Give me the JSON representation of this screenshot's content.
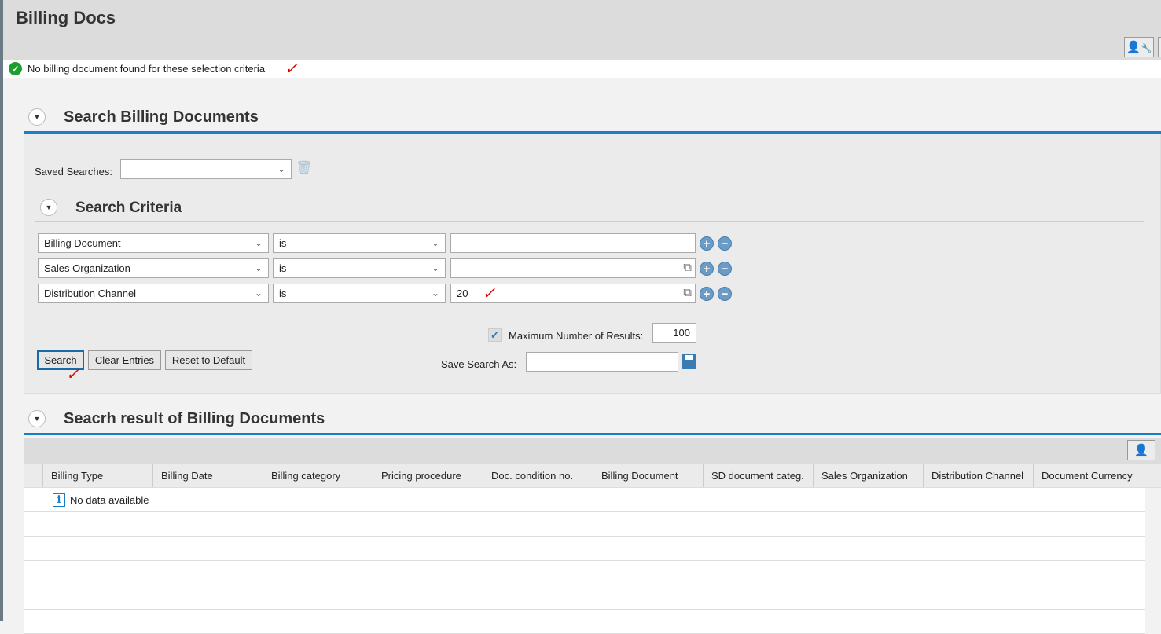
{
  "page": {
    "title": "Billing Docs"
  },
  "message": {
    "text": "No billing document found for these selection criteria",
    "annotation": "✓"
  },
  "search_section": {
    "title": "Search Billing Documents",
    "saved_searches_label": "Saved Searches:",
    "saved_searches_value": "",
    "criteria_title": "Search Criteria",
    "criteria": [
      {
        "field": "Billing Document",
        "operator": "is",
        "value": ""
      },
      {
        "field": "Sales Organization",
        "operator": "is",
        "value": ""
      },
      {
        "field": "Distribution Channel",
        "operator": "is",
        "value": "20"
      }
    ],
    "max_results_label": "Maximum Number of Results:",
    "max_results_checked": true,
    "max_results_value": "100",
    "save_as_label": "Save Search As:",
    "save_as_value": "",
    "buttons": {
      "search": "Search",
      "clear": "Clear Entries",
      "reset": "Reset to Default"
    }
  },
  "results_section": {
    "title": "Seacrh result of Billing Documents",
    "columns": [
      "Billing Type",
      "Billing Date",
      "Billing category",
      "Pricing procedure",
      "Doc. condition no.",
      "Billing Document",
      "SD document categ.",
      "Sales Organization",
      "Distribution Channel",
      "Document Currency"
    ],
    "empty_text": "No data available"
  },
  "colors": {
    "accent": "#1a7ec6",
    "success": "#1e9e2e"
  }
}
